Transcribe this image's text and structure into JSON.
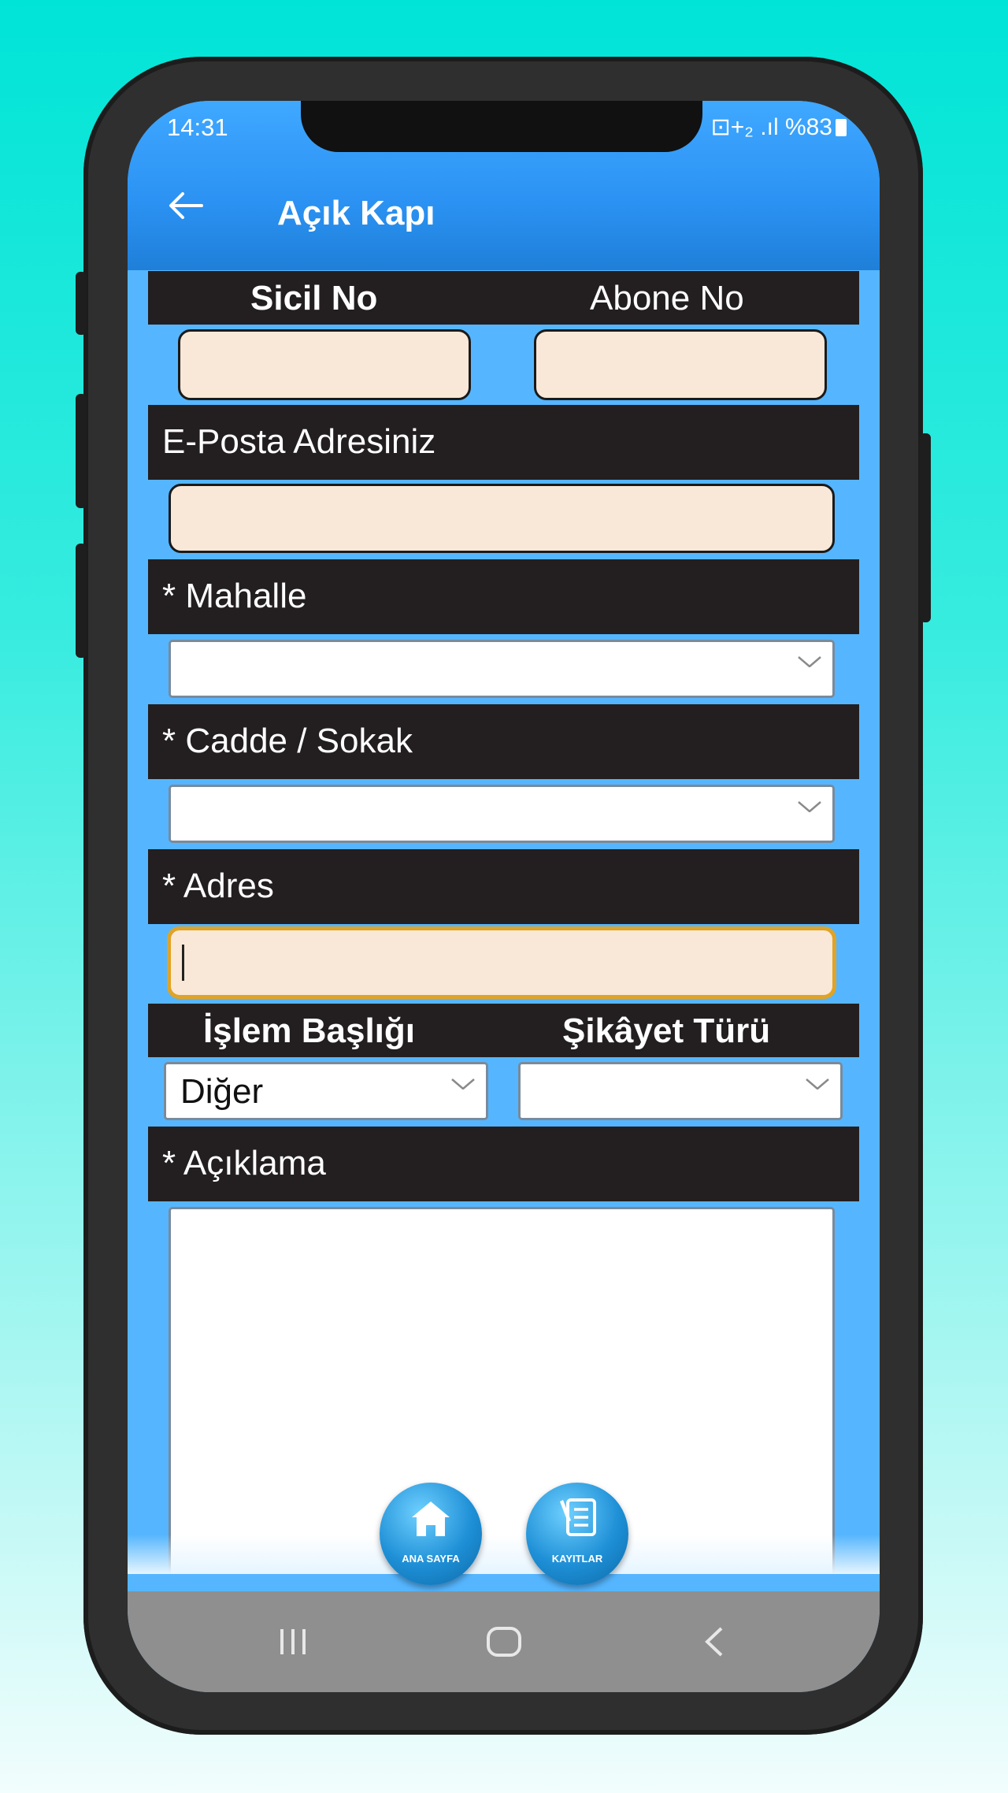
{
  "status": {
    "time": "14:31",
    "right": "⊡+₂ .ıl %83"
  },
  "header": {
    "title": "Açık Kapı"
  },
  "form": {
    "sicil_label": "Sicil No",
    "abone_label": "Abone No",
    "email_label": "E-Posta Adresiniz",
    "mahalle_label": "* Mahalle",
    "cadde_label": "* Cadde / Sokak",
    "adres_label": "* Adres",
    "islem_label": "İşlem Başlığı",
    "islem_value": "Diğer",
    "sikayet_label": "Şikâyet Türü",
    "aciklama_label": "* Açıklama"
  },
  "bottom": {
    "home_label": "ANA SAYFA",
    "records_label": "KAYITLAR"
  },
  "colors": {
    "accent": "#2b92f3",
    "field_bg": "#f9e8d7",
    "focus": "#e0a325",
    "bar": "#231f20"
  }
}
